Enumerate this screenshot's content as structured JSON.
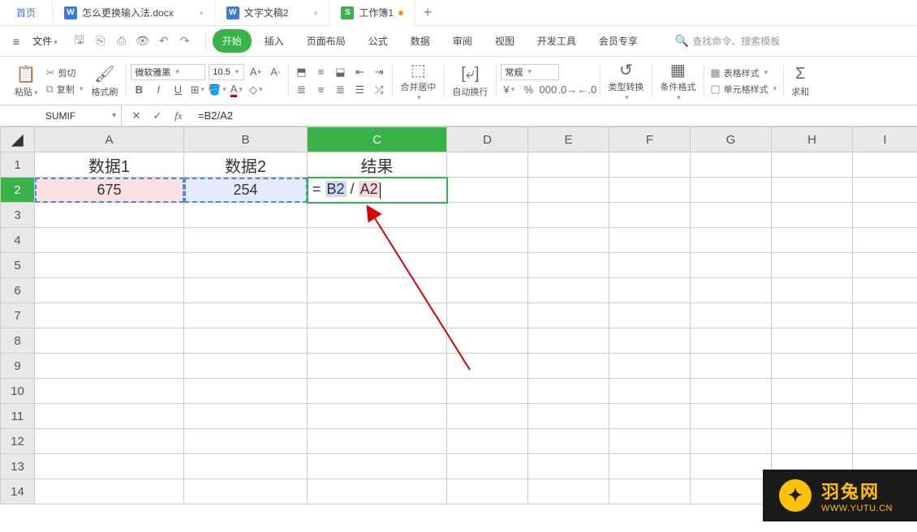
{
  "tabs": {
    "home": "首页",
    "doc1": "怎么更换输入法.docx",
    "doc2": "文字文稿2",
    "doc3": "工作簿1"
  },
  "menubar": {
    "file": "文件",
    "ribbon": [
      "开始",
      "插入",
      "页面布局",
      "公式",
      "数据",
      "审阅",
      "视图",
      "开发工具",
      "会员专享"
    ],
    "search_placeholder": "查找命令、搜索模板"
  },
  "clipboard": {
    "paste": "粘贴",
    "cut": "剪切",
    "copy": "复制",
    "format_painter": "格式刷"
  },
  "font": {
    "name": "微软雅黑",
    "size": "10.5"
  },
  "number_format": "常规",
  "ribbon_right": {
    "merge": "合并居中",
    "wrap": "自动换行",
    "type_convert": "类型转换",
    "cond_fmt": "条件格式",
    "table_style": "表格样式",
    "cell_style": "单元格样式",
    "sum": "求和"
  },
  "formula_bar": {
    "name_box": "SUMIF",
    "formula": "=B2/A2"
  },
  "columns": [
    "A",
    "B",
    "C",
    "D",
    "E",
    "F",
    "G",
    "H",
    "I"
  ],
  "rows": [
    "1",
    "2",
    "3",
    "4",
    "5",
    "6",
    "7",
    "8",
    "9",
    "10",
    "11",
    "12",
    "13",
    "14"
  ],
  "cells": {
    "A1": "数据1",
    "B1": "数据2",
    "C1": "结果",
    "A2": "675",
    "B2": "254",
    "C2_prefix": "= ",
    "C2_ref1": "B2",
    "C2_op": " / ",
    "C2_ref2": "A2"
  },
  "active_cell": "C2",
  "watermark": {
    "name": "羽兔网",
    "url": "WWW.YUTU.CN"
  },
  "chart_data": {
    "type": "table",
    "columns": [
      "数据1",
      "数据2",
      "结果"
    ],
    "rows": [
      [
        675,
        254,
        "=B2/A2"
      ]
    ],
    "note": "Spreadsheet with formula entry dividing B2 by A2"
  }
}
